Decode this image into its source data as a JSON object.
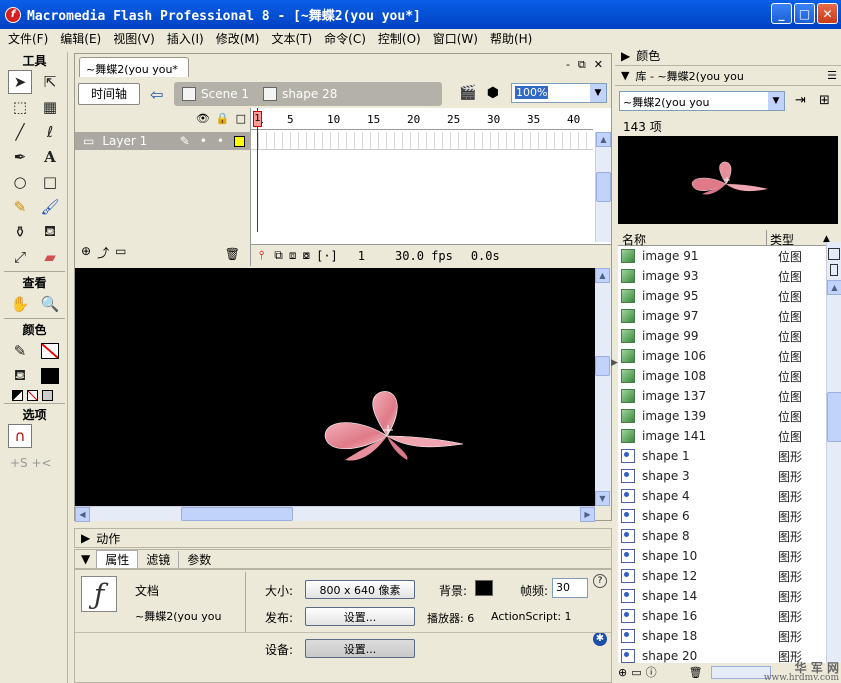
{
  "window": {
    "title": "Macromedia Flash Professional 8 - [~舞蝶2(you you*]",
    "app_icon": "f",
    "buttons": [
      "_",
      "□",
      "✕"
    ]
  },
  "menu": [
    "文件(F)",
    "编辑(E)",
    "视图(V)",
    "插入(I)",
    "修改(M)",
    "文本(T)",
    "命令(C)",
    "控制(O)",
    "窗口(W)",
    "帮助(H)"
  ],
  "tools": {
    "title": "工具",
    "view_title": "查看",
    "color_title": "颜色",
    "options_title": "选项"
  },
  "document": {
    "tab": "~舞蝶2(you you*",
    "controls": [
      "-",
      "⧉",
      "✕"
    ],
    "timeline_button": "时间轴",
    "breadcrumbs": [
      "Scene 1",
      "shape 28"
    ],
    "zoom": "100%"
  },
  "timeline": {
    "ruler": [
      "1",
      "5",
      "10",
      "15",
      "20",
      "25",
      "30",
      "35",
      "40"
    ],
    "layer_name": "Layer 1",
    "current_frame": "1",
    "frame_rate": "30.0 fps",
    "elapsed": "0.0s"
  },
  "panels": {
    "actions": "动作",
    "tabs": [
      "属性",
      "滤镜",
      "参数"
    ],
    "color": "颜色",
    "library_title": "库 - ~舞蝶2(you you"
  },
  "properties": {
    "type": "文档",
    "doc_name": "~舞蝶2(you you",
    "size_label": "大小:",
    "size_value": "800 x 640 像素",
    "bg_label": "背景:",
    "fps_label": "帧频:",
    "fps_value": "30",
    "publish_label": "发布:",
    "publish_button": "设置...",
    "player_label": "播放器: 6",
    "actionscript_label": "ActionScript: 1",
    "device_label": "设备:",
    "device_button": "设置..."
  },
  "library": {
    "select": "~舞蝶2(you you",
    "count": "143 项",
    "col_name": "名称",
    "col_type": "类型",
    "items": [
      {
        "name": "image 91",
        "type": "位图",
        "kind": "bitmap"
      },
      {
        "name": "image 93",
        "type": "位图",
        "kind": "bitmap"
      },
      {
        "name": "image 95",
        "type": "位图",
        "kind": "bitmap"
      },
      {
        "name": "image 97",
        "type": "位图",
        "kind": "bitmap"
      },
      {
        "name": "image 99",
        "type": "位图",
        "kind": "bitmap"
      },
      {
        "name": "image 106",
        "type": "位图",
        "kind": "bitmap"
      },
      {
        "name": "image 108",
        "type": "位图",
        "kind": "bitmap"
      },
      {
        "name": "image 137",
        "type": "位图",
        "kind": "bitmap"
      },
      {
        "name": "image 139",
        "type": "位图",
        "kind": "bitmap"
      },
      {
        "name": "image 141",
        "type": "位图",
        "kind": "bitmap"
      },
      {
        "name": "shape 1",
        "type": "图形",
        "kind": "shape"
      },
      {
        "name": "shape 3",
        "type": "图形",
        "kind": "shape"
      },
      {
        "name": "shape 4",
        "type": "图形",
        "kind": "shape"
      },
      {
        "name": "shape 6",
        "type": "图形",
        "kind": "shape"
      },
      {
        "name": "shape 8",
        "type": "图形",
        "kind": "shape"
      },
      {
        "name": "shape 10",
        "type": "图形",
        "kind": "shape"
      },
      {
        "name": "shape 12",
        "type": "图形",
        "kind": "shape"
      },
      {
        "name": "shape 14",
        "type": "图形",
        "kind": "shape"
      },
      {
        "name": "shape 16",
        "type": "图形",
        "kind": "shape"
      },
      {
        "name": "shape 18",
        "type": "图形",
        "kind": "shape"
      },
      {
        "name": "shape 20",
        "type": "图形",
        "kind": "shape"
      }
    ]
  },
  "watermark": {
    "line1": "华 军 网",
    "line2": "www.hrdmv.com"
  },
  "colors": {
    "stage": "#000000",
    "titlebar": "#0653d8",
    "butterfly": "#e7828f"
  }
}
